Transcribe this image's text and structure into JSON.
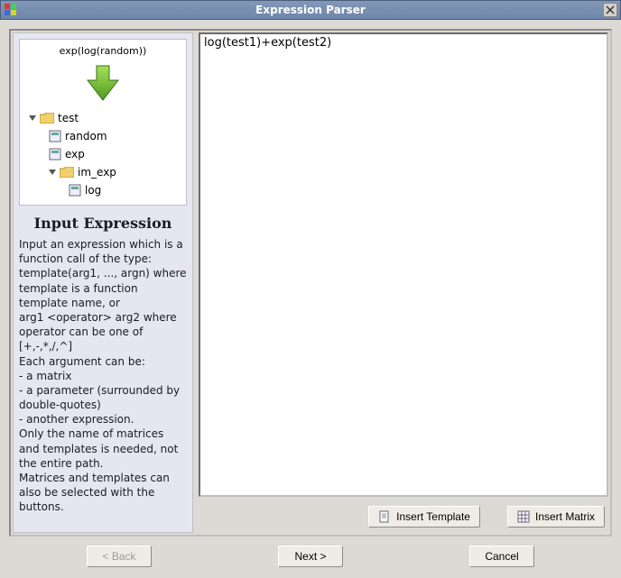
{
  "window": {
    "title": "Expression Parser"
  },
  "tree": {
    "header": "exp(log(random))",
    "root": {
      "label": "test",
      "children": [
        {
          "label": "random"
        },
        {
          "label": "exp"
        },
        {
          "label": "im_exp",
          "children": [
            {
              "label": "log"
            }
          ]
        }
      ]
    }
  },
  "help": {
    "title": "Input Expression",
    "body": "Input an expression which is a function call of the type: template(arg1, ..., argn) where template is a function template name, or\narg1 <operator> arg2 where operator can be one of [+,-,*,/,^]\nEach argument can be:\n - a matrix\n - a parameter (surrounded by double-quotes)\n - another expression.\nOnly the name of matrices and templates is needed, not the entire path.\nMatrices and templates can also be selected with the buttons."
  },
  "editor": {
    "value": "log(test1)+exp(test2)"
  },
  "buttons": {
    "insert_template": "Insert Template",
    "insert_matrix": "Insert Matrix",
    "back": "< Back",
    "next": "Next >",
    "cancel": "Cancel"
  }
}
